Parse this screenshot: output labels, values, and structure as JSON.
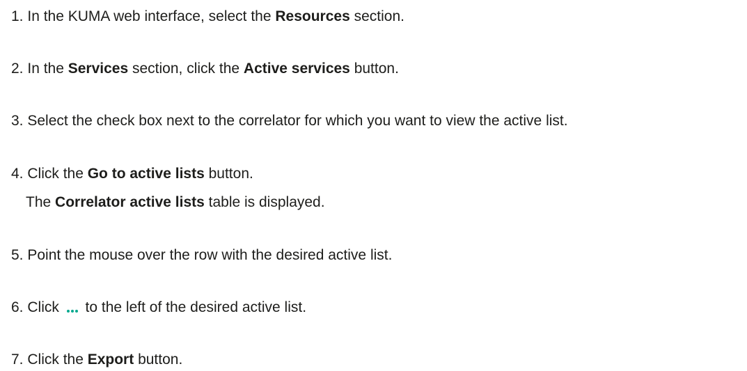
{
  "steps": [
    {
      "num": "1.",
      "t1": "In the KUMA web interface, select the ",
      "b1": "Resources",
      "t2": " section."
    },
    {
      "num": "2.",
      "t1": "In the ",
      "b1": "Services",
      "t2": " section, click the ",
      "b2": "Active services",
      "t3": " button."
    },
    {
      "num": "3.",
      "t1": "Select the check box next to the correlator for which you want to view the active list."
    },
    {
      "num": "4.",
      "t1": "Click the ",
      "b1": "Go to active lists",
      "t2": " button."
    },
    {
      "num": "5.",
      "t1": "Point the mouse over the row with the desired active list."
    },
    {
      "num": "6.",
      "t1": "Click ",
      "t2": " to the left of the desired active list."
    },
    {
      "num": "7.",
      "t1": "Click the ",
      "b1": "Export",
      "t2": " button."
    }
  ],
  "step4_result": {
    "t1": "The ",
    "b1": "Correlator active lists",
    "t2": " table is displayed."
  },
  "icons": {
    "more_actions": "more-actions-icon",
    "accent_color": "#00a88e"
  }
}
